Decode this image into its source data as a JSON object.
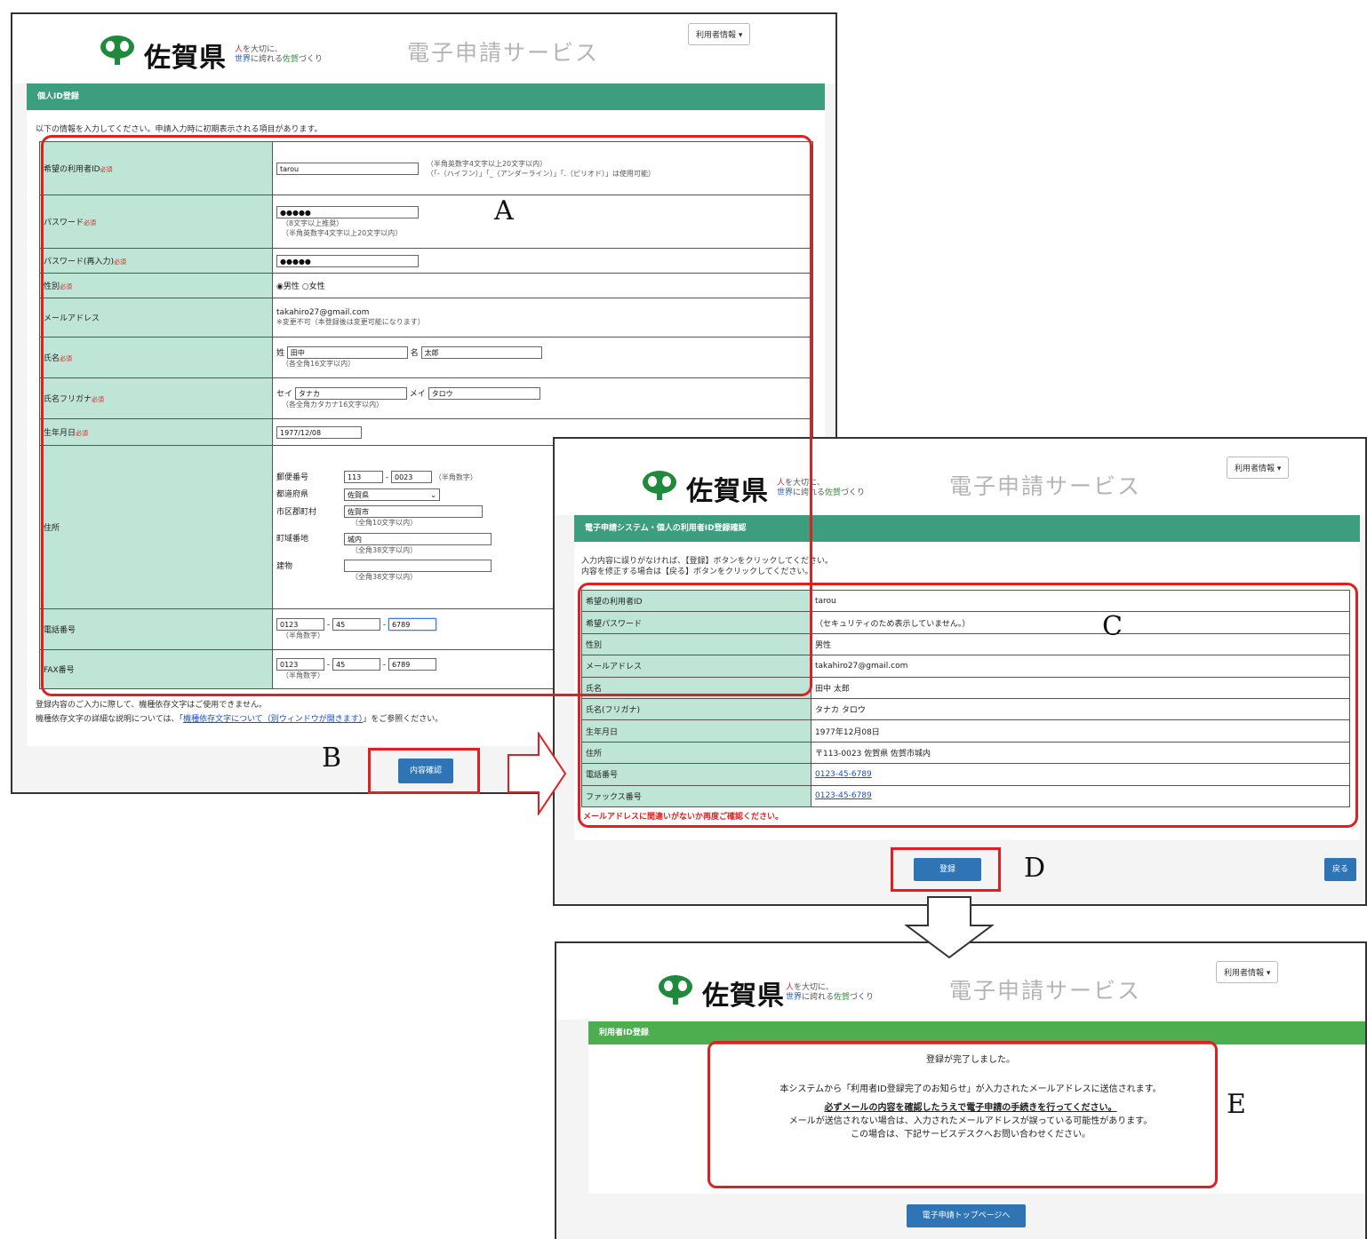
{
  "logo": {
    "prefecture": "佐賀県",
    "tagline_line1_red": "人",
    "tagline_line1_rest": "を大切に、",
    "tagline_line2_blue": "世界",
    "tagline_line2_mid": "に誇れる",
    "tagline_line2_green": "佐賀",
    "tagline_line2_end": "づくり",
    "service": "電子申請サービス"
  },
  "user_menu": "利用者情報 ▾",
  "screen1": {
    "section_title": "個人ID登録",
    "intro": "以下の情報を入力してください。申請入力時に初期表示される項目があります。",
    "required": "必須",
    "rows": {
      "userid_label": "希望の利用者ID",
      "userid_value": "tarou",
      "userid_note1": "（半角英数字4文字以上20文字以内）",
      "userid_note2": "（「-（ハイフン）」「_（アンダーライン）」「.（ピリオド）」は使用可能）",
      "pw_label": "パスワード",
      "pw_value": "●●●●●",
      "pw_note1": "（8文字以上推奨）",
      "pw_note2": "（半角英数字4文字以上20文字以内）",
      "pw2_label": "パスワード(再入力)",
      "pw2_value": "●●●●●",
      "gender_label": "性別",
      "gender_value": "◉男性 ○女性",
      "email_label": "メールアドレス",
      "email_value": "takahiro27@gmail.com",
      "email_note": "※変更不可（本登録後は変更可能になります）",
      "name_label": "氏名",
      "sei_label": "姓",
      "sei_value": "田中",
      "mei_label": "名",
      "mei_value": "太郎",
      "name_note": "（各全角16文字以内）",
      "kana_label": "氏名フリガナ",
      "kana_sei_label": "セイ",
      "kana_sei_value": "タナカ",
      "kana_mei_label": "メイ",
      "kana_mei_value": "タロウ",
      "kana_note": "（各全角カタカナ16文字以内）",
      "birth_label": "生年月日",
      "birth_value": "1977/12/08",
      "addr_label": "住所",
      "zip_label": "郵便番号",
      "zip1": "113",
      "zip2": "0023",
      "zip_note": "（半角数字）",
      "pref_label": "都道府県",
      "pref_value": "佐賀県",
      "city_label": "市区郡町村",
      "city_value": "佐賀市",
      "city_note": "（全角10文字以内）",
      "town_label": "町域番地",
      "town_value": "城内",
      "town_note": "（全角38文字以内）",
      "bldg_label": "建物",
      "bldg_value": "",
      "bldg_note": "（全角38文字以内）",
      "tel_label": "電話番号",
      "tel1": "0123",
      "tel2": "45",
      "tel3": "6789",
      "tel_note": "（半角数字）",
      "fax_label": "FAX番号",
      "fax1": "0123",
      "fax2": "45",
      "fax3": "6789",
      "fax_note": "（半角数字）"
    },
    "footer1": "登録内容のご入力に際して、機種依存文字はご使用できません。",
    "footer2_pre": "機種依存文字の詳細な説明については、「",
    "footer2_link": "機種依存文字について（別ウィンドウが開きます）",
    "footer2_post": "」をご参照ください。",
    "confirm_button": "内容確認"
  },
  "screen2": {
    "section_title": "電子申請システム・個人の利用者ID登録確認",
    "intro1": "入力内容に誤りがなければ、【登録】ボタンをクリックしてください。",
    "intro2": "内容を修正する場合は【戻る】ボタンをクリックしてください。",
    "rows": [
      {
        "label": "希望の利用者ID",
        "value": "tarou",
        "link": false
      },
      {
        "label": "希望パスワード",
        "value": "（セキュリティのため表示していません。）",
        "link": false
      },
      {
        "label": "性別",
        "value": "男性",
        "link": false
      },
      {
        "label": "メールアドレス",
        "value": "takahiro27@gmail.com",
        "link": false
      },
      {
        "label": "氏名",
        "value": "田中 太郎",
        "link": false
      },
      {
        "label": "氏名(フリガナ)",
        "value": "タナカ タロウ",
        "link": false
      },
      {
        "label": "生年月日",
        "value": "1977年12月08日",
        "link": false
      },
      {
        "label": "住所",
        "value": "〒113-0023 佐賀県 佐賀市城内",
        "link": false
      },
      {
        "label": "電話番号",
        "value": "0123-45-6789",
        "link": true
      },
      {
        "label": "ファックス番号",
        "value": "0123-45-6789",
        "link": true
      }
    ],
    "warning": "メールアドレスに間違いがないか再度ご確認ください。",
    "register_button": "登録",
    "back_button": "戻る"
  },
  "screen3": {
    "section_title": "利用者ID登録",
    "line1": "登録が完了しました。",
    "line2": "本システムから「利用者ID登録完了のお知らせ」が入力されたメールアドレスに送信されます。",
    "line3": "必ずメールの内容を確認したうえで電子申請の手続きを行ってください。",
    "line4": "メールが送信されない場合は、入力されたメールアドレスが誤っている可能性があります。",
    "line5": "この場合は、下記サービスデスクへお問い合わせください。",
    "top_button": "電子申請トップページへ"
  },
  "annotations": {
    "a": "A",
    "b": "B",
    "c": "C",
    "d": "D",
    "e": "E"
  },
  "colors": {
    "accent_green": "#3d9e7f",
    "label_bg": "#bfe5d6",
    "button_blue": "#2f74b5",
    "highlight_red": "#e02020"
  }
}
